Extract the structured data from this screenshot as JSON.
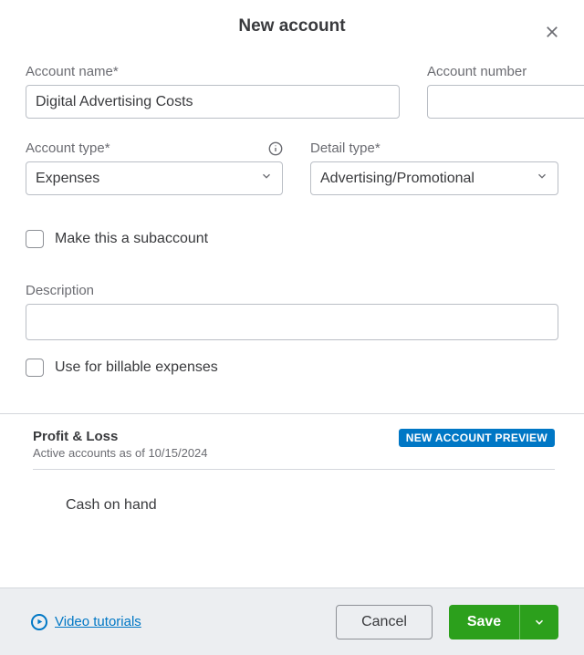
{
  "header": {
    "title": "New account"
  },
  "fields": {
    "account_name": {
      "label": "Account name*",
      "value": "Digital Advertising Costs"
    },
    "account_number": {
      "label": "Account number",
      "value": ""
    },
    "account_type": {
      "label": "Account type*",
      "value": "Expenses"
    },
    "detail_type": {
      "label": "Detail type*",
      "value": "Advertising/Promotional"
    },
    "subaccount": {
      "label": "Make this a subaccount"
    },
    "description": {
      "label": "Description",
      "value": ""
    },
    "billable": {
      "label": "Use for billable expenses"
    }
  },
  "preview": {
    "title": "Profit & Loss",
    "subtitle": "Active accounts as of 10/15/2024",
    "badge": "NEW ACCOUNT PREVIEW",
    "item": "Cash on hand"
  },
  "footer": {
    "tutorials": "Video tutorials",
    "cancel": "Cancel",
    "save": "Save"
  }
}
